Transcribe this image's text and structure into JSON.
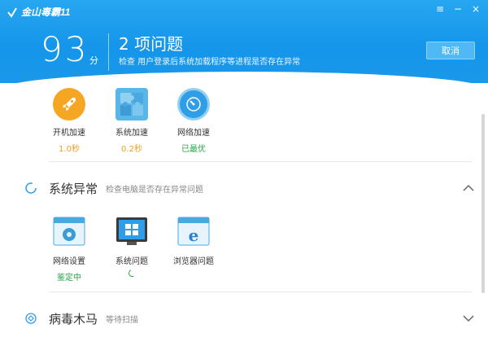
{
  "app": {
    "logo_text": "金山毒霸11",
    "controls": {
      "menu": "≡",
      "minimize": "−",
      "close": "×"
    }
  },
  "header": {
    "score": "93",
    "score_unit": "分",
    "issue_title": "2 项问题",
    "issue_subtitle": "检查 用户登录后系统加载程序等进程是否存在异常",
    "cancel_label": "取消"
  },
  "speedup": {
    "items": [
      {
        "label": "开机加速",
        "value": "1.0秒",
        "value_color": "#f0a020",
        "icon": "rocket-icon"
      },
      {
        "label": "系统加速",
        "value": "0.2秒",
        "value_color": "#f0a020",
        "icon": "puzzle-icon"
      },
      {
        "label": "网络加速",
        "value": "已最优",
        "value_color": "#2aa34a",
        "icon": "speedometer-icon"
      }
    ]
  },
  "system_section": {
    "title": "系统异常",
    "note": "检查电脑是否存在异常问题",
    "items": [
      {
        "label": "网络设置",
        "status": "鉴定中",
        "status_color": "#2aa34a",
        "icon": "network-settings-icon"
      },
      {
        "label": "系统问题",
        "status": "",
        "icon": "windows-icon"
      },
      {
        "label": "浏览器问题",
        "status": "",
        "icon": "ie-browser-icon"
      }
    ]
  },
  "virus_section": {
    "title": "病毒木马",
    "note": "等待扫描"
  },
  "colors": {
    "header_blue": "#1596ea",
    "accent_orange": "#f0a020",
    "accent_green": "#2aa34a"
  }
}
